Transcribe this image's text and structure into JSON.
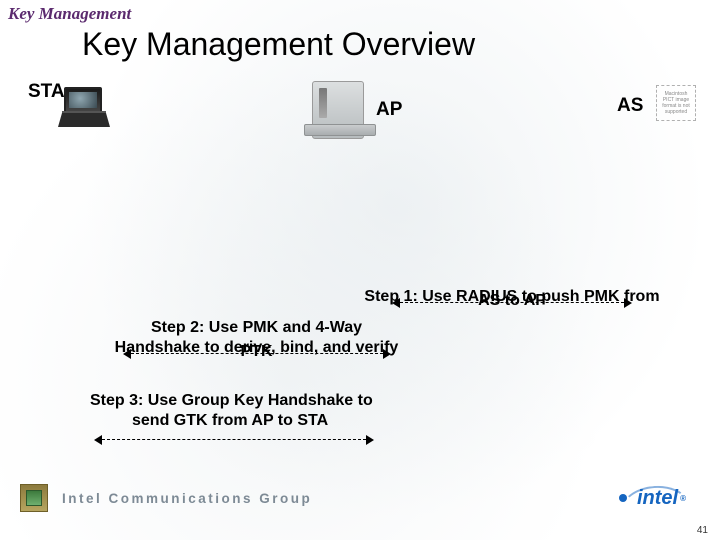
{
  "section_label": "Key Management",
  "title": "Key Management Overview",
  "nodes": {
    "sta": "STA",
    "ap": "AP",
    "as": "AS",
    "pict_placeholder": "Macintosh PICT image format is not supported"
  },
  "steps": {
    "s1_line1": "Step 1: Use RADIUS to push PMK from",
    "s1_line2": "AS to AP",
    "s2_line1": "Step 2: Use PMK and 4-Way",
    "s2_line2": "Handshake to derive, bind, and verify",
    "s2_line3": "PTK",
    "s3_line1": "Step 3: Use Group Key Handshake to",
    "s3_line2": "send GTK from AP to STA"
  },
  "footer": {
    "group": "Intel Communications Group",
    "brand": "intel",
    "reg": "®"
  },
  "page_number": "41"
}
